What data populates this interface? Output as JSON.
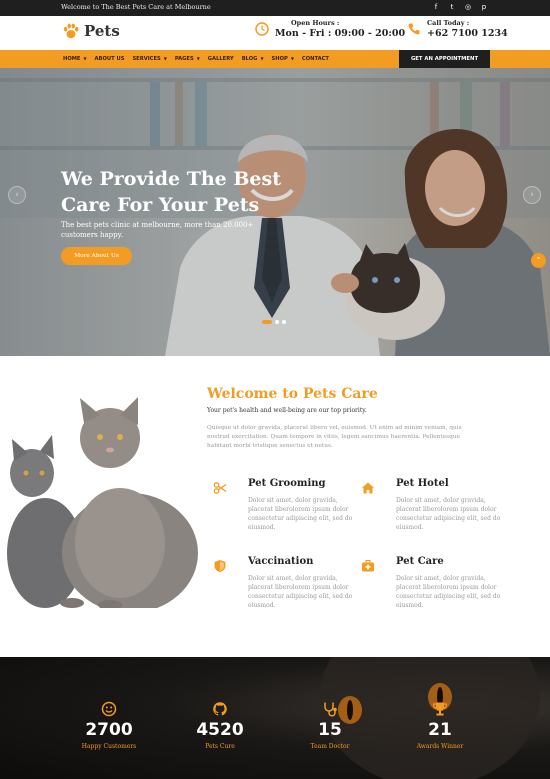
{
  "colors": {
    "accent": "#f39c24",
    "dark": "#1f1f1f"
  },
  "topbar": {
    "welcome": "Welcome to The Best Pets Care at Melbourne",
    "socials": [
      {
        "icon": "facebook-icon",
        "glyph": "f"
      },
      {
        "icon": "twitter-icon",
        "glyph": "t"
      },
      {
        "icon": "instagram-icon",
        "glyph": "◎"
      },
      {
        "icon": "pinterest-icon",
        "glyph": "p"
      }
    ]
  },
  "header": {
    "logo_text": "Pets",
    "hours_label": "Open Hours :",
    "hours_value": "Mon - Fri : 09:00 - 20:00",
    "call_label": "Call Today :",
    "call_value": "+62 7100 1234"
  },
  "nav": {
    "items": [
      {
        "label": "HOME",
        "dropdown": true
      },
      {
        "label": "ABOUT US",
        "dropdown": false
      },
      {
        "label": "SERVICES",
        "dropdown": true
      },
      {
        "label": "PAGES",
        "dropdown": true
      },
      {
        "label": "GALLERY",
        "dropdown": false
      },
      {
        "label": "BLOG",
        "dropdown": true
      },
      {
        "label": "SHOP",
        "dropdown": true
      },
      {
        "label": "CONTACT",
        "dropdown": false
      }
    ],
    "appointment": "GET AN APPOINTMENT"
  },
  "hero": {
    "title": "We Provide The Best Care For Your Pets",
    "subtitle": "The best pets clinic at melbourne, more than 20.000+ customers happy.",
    "cta": "More About Us",
    "prev_glyph": "‹",
    "next_glyph": "›",
    "scroll_glyph": "⌃"
  },
  "welcome": {
    "title": "Welcome to Pets Care",
    "subtitle": "Your pet's health and well-being are our top priority.",
    "paragraph": "Quisque ut dolor gravida, placerat libero vel, euismod. Ut enim ad minim veniam, quis nostrud exercitation. Quam tempore in vitiis, legem sancimus haerentia. Pellentesque habitant morbi tristique senectus et netus.",
    "services": [
      {
        "title": "Pet Grooming",
        "icon": "scissors-icon",
        "text": "Dolor sit amet, dolor gravida, placerat liberolorem ipsum dolor consectetur adipiscing elit, sed do eiusmod."
      },
      {
        "title": "Pet Hotel",
        "icon": "home-icon",
        "text": "Dolor sit amet, dolor gravida, placerat liberolorem ipsum dolor consectetur adipiscing elit, sed do eiusmod."
      },
      {
        "title": "Vaccination",
        "icon": "shield-icon",
        "text": "Dolor sit amet, dolor gravida, placerat liberolorem ipsum dolor consectetur adipiscing elit, sed do eiusmod."
      },
      {
        "title": "Pet Care",
        "icon": "medical-kit-icon",
        "text": "Dolor sit amet, dolor gravida, placerat liberolorem ipsum dolor consectetur adipiscing elit, sed do eiusmod."
      }
    ]
  },
  "stats": [
    {
      "value": "2700",
      "label": "Happy Customers",
      "icon": "smile-icon"
    },
    {
      "value": "4520",
      "label": "Pets Cure",
      "icon": "github-icon"
    },
    {
      "value": "15",
      "label": "Team Doctor",
      "icon": "stethoscope-icon"
    },
    {
      "value": "21",
      "label": "Awards Winner",
      "icon": "trophy-icon"
    }
  ]
}
